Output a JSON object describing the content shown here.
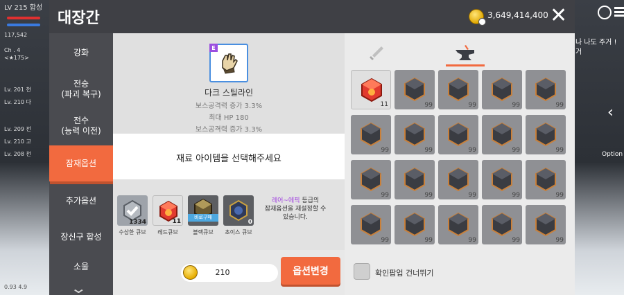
{
  "header": {
    "title": "대장간",
    "gold": "3,649,414,400"
  },
  "sidebar": {
    "items": [
      {
        "label": "강화"
      },
      {
        "label": "전승\n(파괴 복구)"
      },
      {
        "label": "전수\n(능력 이전)"
      },
      {
        "label": "잠재옵션"
      },
      {
        "label": "추가옵션"
      },
      {
        "label": "장신구 합성"
      },
      {
        "label": "소울"
      }
    ],
    "active_index": 3
  },
  "item": {
    "grade_badge": "E",
    "name": "다크 스틸라인",
    "stats": [
      "보스공격력 증가 3.3%",
      "최대 HP 180",
      "보스공격력 증가 3.3%"
    ]
  },
  "select_prompt": "재료 아이템을 선택해주세요",
  "cubes": [
    {
      "label": "수상한 큐브",
      "count": "1334",
      "color": "#9ea3aa"
    },
    {
      "label": "레드큐브",
      "count": "11",
      "color": "#e23a2f"
    },
    {
      "label": "블랙큐브",
      "count": "",
      "buy": "바로구매",
      "color": "#6a5a32"
    },
    {
      "label": "초이스 큐브",
      "count": "0",
      "color": "#2f3a5a"
    }
  ],
  "description": {
    "highlight": "레어~에픽",
    "text1": " 등급의",
    "text2": "잠재옵션을 재설정할 수",
    "text3": "있습니다."
  },
  "price": "210",
  "change_button": "옵션변경",
  "skip_label": "확인팝업 건너뛰기",
  "inventory": {
    "first_count": "11",
    "other_count": "99",
    "slots": 20
  },
  "background_hud": {
    "name": "LV 215 합성",
    "power": "117,542",
    "chapter": "Ch . 4",
    "stage": "<★175>",
    "party": [
      "Lv. 201 천",
      "Lv. 210 다",
      "Lv. 209 전",
      "Lv. 210 고",
      "Lv. 208 천"
    ],
    "chat": "나 나도 주거 !",
    "chat2": "거",
    "option": "Option",
    "bottom_val": "0.93 4.9"
  }
}
